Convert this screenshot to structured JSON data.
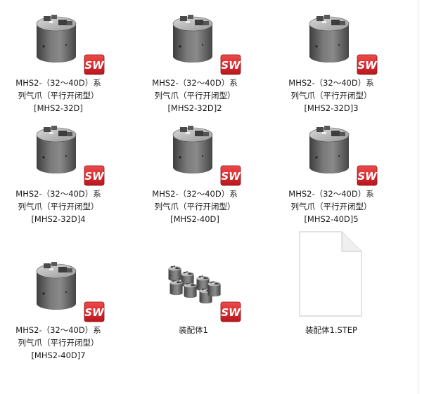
{
  "files": [
    {
      "line1": "MHS2-（32～40D）系",
      "line2": "列气爪（平行开闭型）",
      "line3": "[MHS2-32D]",
      "icon": "solidworks-part-icon"
    },
    {
      "line1": "MHS2-（32～40D）系",
      "line2": "列气爪（平行开闭型）",
      "line3": "[MHS2-32D]2",
      "icon": "solidworks-part-icon"
    },
    {
      "line1": "MHS2-（32～40D）系",
      "line2": "列气爪（平行开闭型）",
      "line3": "[MHS2-32D]3",
      "icon": "solidworks-part-icon"
    },
    {
      "line1": "MHS2-（32～40D）系",
      "line2": "列气爪（平行开闭型）",
      "line3": "[MHS2-32D]4",
      "icon": "solidworks-part-icon"
    },
    {
      "line1": "MHS2-（32～40D）系",
      "line2": "列气爪（平行开闭型）",
      "line3": "[MHS2-40D]",
      "icon": "solidworks-part-icon"
    },
    {
      "line1": "MHS2-（32～40D）系",
      "line2": "列气爪（平行开闭型）",
      "line3": "[MHS2-40D]5",
      "icon": "solidworks-part-icon"
    },
    {
      "line1": "MHS2-（32～40D）系",
      "line2": "列气爪（平行开闭型）",
      "line3": "[MHS2-40D]7",
      "icon": "solidworks-part-icon"
    },
    {
      "line1": "装配体1",
      "icon": "solidworks-assembly-icon"
    },
    {
      "line1": "装配体1.STEP",
      "icon": "blank-document-icon"
    }
  ],
  "colors": {
    "sw_badge": "#d4232a",
    "gripper_body": "#6e6e6e",
    "background": "#ffffff"
  }
}
